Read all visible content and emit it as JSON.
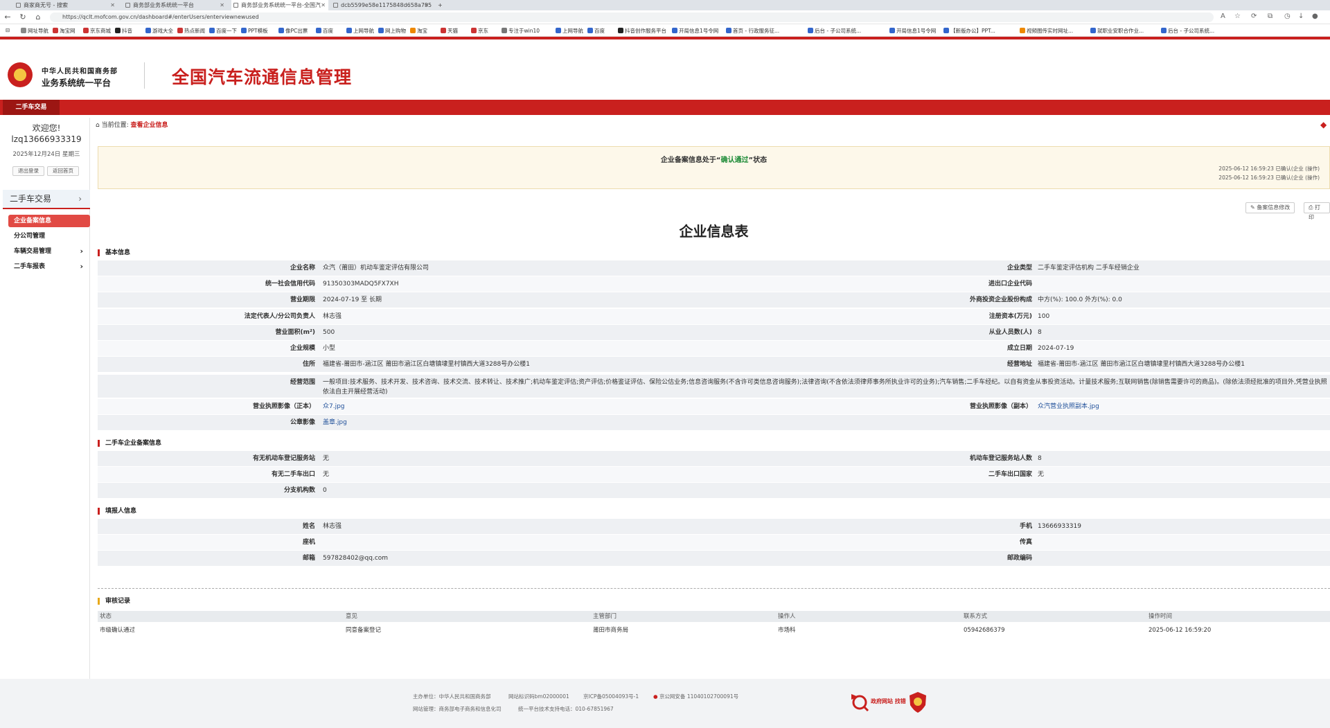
{
  "browser": {
    "tabs": [
      {
        "label": "商家商无号 - 搜索",
        "active": false
      },
      {
        "label": "商务部业务系统统一平台",
        "active": false
      },
      {
        "label": "商务部业务系统统一平台-全国汽",
        "active": true
      },
      {
        "label": "dcb5599e58e1175848d658a7955",
        "active": false
      }
    ],
    "new_tab": "+",
    "url": "https://qclt.mofcom.gov.cn/dashboard#/enterUsers/enterviewnewused",
    "bookmarks": [
      "网址导航",
      "淘宝网",
      "京东商城",
      "抖音",
      "游戏大全",
      "热点新闻",
      "百度一下",
      "PPT模板",
      "像PC出票",
      "百度",
      "上网导航",
      "网上购物",
      "淘宝",
      "天猫",
      "京东",
      "专注于win10",
      "上网导航",
      "百度",
      "抖音创作服务平台",
      "开局信息1号令网",
      "首页 - 行政服务征...",
      "后台 - 子公司系统...",
      "开局信息1号令网",
      "【新版办公】PPT...",
      "视频图传实时网址...",
      "就职业安职合作业...",
      "后台 - 子公司系统..."
    ]
  },
  "header": {
    "org_line1": "中华人民共和国商务部",
    "org_line2": "业务系统统一平台",
    "system_title": "全国汽车流通信息管理",
    "nav_tab": "二手车交易"
  },
  "sidebar": {
    "welcome": "欢迎您!",
    "username": "lzq13666933319",
    "date": "2025年12月24日 星期三",
    "logout_label": "退出登录",
    "home_label": "返回首页",
    "section": "二手车交易",
    "items": [
      {
        "label": "企业备案信息",
        "active": true,
        "has_arrow": false
      },
      {
        "label": "分公司管理",
        "active": false,
        "has_arrow": false
      },
      {
        "label": "车辆交易管理",
        "active": false,
        "has_arrow": true
      },
      {
        "label": "二手车报表",
        "active": false,
        "has_arrow": true
      }
    ]
  },
  "breadcrumb": {
    "prefix": "当前位置:",
    "current": "查看企业信息"
  },
  "status": {
    "text_before": "企业备案信息处于“",
    "highlight": "确认通过",
    "text_after": "”状态",
    "log_lines": [
      "2025-06-12 16:59:23 已确认(企业 (操作)",
      "2025-06-12 16:59:23 已确认(企业 (操作)"
    ]
  },
  "toolbar": {
    "edit_label": "备案信息修改",
    "print_label": "打印"
  },
  "form_title": "企业信息表",
  "basic_info": {
    "section_title": "基本信息",
    "rows": [
      {
        "l_label": "企业名称",
        "l_value": "众汽（莆田）机动车鉴定评估有限公司",
        "r_label": "企业类型",
        "r_value": "二手车鉴定评估机构 二手车经销企业"
      },
      {
        "l_label": "统一社会信用代码",
        "l_value": "91350303MADQ5FX7XH",
        "r_label": "进出口企业代码",
        "r_value": ""
      },
      {
        "l_label": "营业期限",
        "l_value": "2024-07-19 至 长期",
        "r_label": "外商投资企业股份构成",
        "r_value": "中方(%): 100.0  外方(%): 0.0"
      },
      {
        "l_label": "法定代表人/分公司负责人",
        "l_value": "林志强",
        "r_label": "注册资本(万元)",
        "r_value": "100"
      },
      {
        "l_label": "营业面积(m²)",
        "l_value": "500",
        "r_label": "从业人员数(人)",
        "r_value": "8"
      },
      {
        "l_label": "企业规模",
        "l_value": "小型",
        "r_label": "成立日期",
        "r_value": "2024-07-19"
      },
      {
        "l_label": "住所",
        "l_value": "福建省-莆田市-涵江区 莆田市涵江区白塘镇埭里村镇西大道3288号办公楼1",
        "r_label": "经营地址",
        "r_value": "福建省-莆田市-涵江区 莆田市涵江区白塘镇埭里村镇西大道3288号办公楼1"
      }
    ],
    "scope_label": "经营范围",
    "scope_value": "一般项目:技术服务、技术开发、技术咨询、技术交流、技术转让、技术推广;机动车鉴定评估;资产评估;价格鉴证评估、保险公估业务;信息咨询服务(不含许可类信息咨询服务);法律咨询(不含依法须律师事务所执业许可的业务);汽车销售;二手车经纪。以自有资金从事投资活动。计量技术服务;互联网销售(除销售需要许可的商品)。(除依法须经批准的项目外,凭营业执照依法自主开展经营活动)",
    "license_label": "营业执照影像（正本）",
    "license_value": "众7.jpg",
    "license_copy_label": "营业执照影像（副本）",
    "license_copy_value": "众汽营业执照副本.jpg",
    "seal_label": "公章影像",
    "seal_value": "盖章.jpg"
  },
  "used_car_info": {
    "section_title": "二手车企业备案信息",
    "rows": [
      {
        "l_label": "有无机动车登记服务站",
        "l_value": "无",
        "r_label": "机动车登记服务站人数",
        "r_value": "8"
      },
      {
        "l_label": "有无二手车出口",
        "l_value": "无",
        "r_label": "二手车出口国家",
        "r_value": "无"
      }
    ],
    "branch_label": "分支机构数",
    "branch_value": "0"
  },
  "filler_info": {
    "section_title": "填报人信息",
    "rows": [
      {
        "l_label": "姓名",
        "l_value": "林志强",
        "r_label": "手机",
        "r_value": "13666933319"
      },
      {
        "l_label": "座机",
        "l_value": "",
        "r_label": "传真",
        "r_value": ""
      },
      {
        "l_label": "邮箱",
        "l_value": "597828402@qq.com",
        "r_label": "邮政编码",
        "r_value": ""
      }
    ]
  },
  "audit": {
    "section_title": "审核记录",
    "headers": [
      "状态",
      "意见",
      "主管部门",
      "操作人",
      "联系方式",
      "操作时间"
    ],
    "rows": [
      [
        "市级确认通过",
        "同意备案登记",
        "莆田市商务局",
        "市场科",
        "05942686379",
        "2025-06-12 16:59:20"
      ]
    ]
  },
  "footer": {
    "line1": [
      "主办单位：中华人民共和国商务部",
      "网站标识码bm02000001",
      "京ICP备05004093号-1",
      "京公网安备 11040102700091号"
    ],
    "line2": [
      "网站管理：商务部电子商务和信息化司",
      "统一平台技术支持电话：010-67851967"
    ],
    "gov_badge": "政府网站 找错"
  }
}
